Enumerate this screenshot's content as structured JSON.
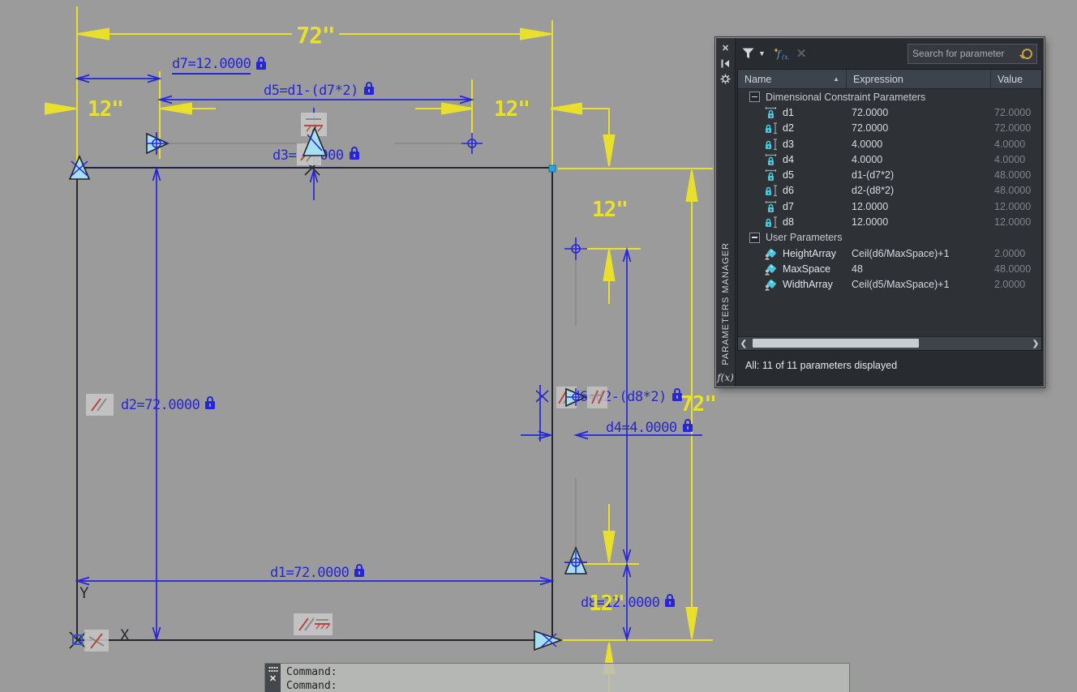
{
  "canvas": {
    "yellow_labels": {
      "top_width": "72\"",
      "top_left_gap": "12\"",
      "top_right_gap": "12\"",
      "right_height": "72\"",
      "right_top_offset": "12\"",
      "right_bottom_offset": "12\""
    },
    "dims": {
      "d7": "d7=12.0000",
      "d5": "d5=d1-(d7*2)",
      "d3": "d3=4.0000",
      "d2": "d2=72.0000",
      "d1": "d1=72.0000",
      "d6": "d6=d2-(d8*2)",
      "d4": "d4=4.0000",
      "d8": "d8=12.0000"
    },
    "axis": {
      "x": "X",
      "y": "Y"
    }
  },
  "command_window": {
    "line1": "Command:",
    "line2": "Command:"
  },
  "palette": {
    "title": "PARAMETERS MANAGER",
    "fx_label": "f(x)",
    "search_placeholder": "Search for parameter",
    "columns": {
      "name": "Name",
      "expression": "Expression",
      "value": "Value"
    },
    "status": "All: 11 of 11 parameters displayed",
    "groups": [
      {
        "label": "Dimensional Constraint Parameters",
        "rows": [
          {
            "icon": "dim-h",
            "name": "d1",
            "expression": "72.0000",
            "value": "72.0000"
          },
          {
            "icon": "dim-v",
            "name": "d2",
            "expression": "72.0000",
            "value": "72.0000"
          },
          {
            "icon": "dim-v",
            "name": "d3",
            "expression": "4.0000",
            "value": "4.0000"
          },
          {
            "icon": "dim-h",
            "name": "d4",
            "expression": "4.0000",
            "value": "4.0000"
          },
          {
            "icon": "dim-h",
            "name": "d5",
            "expression": "d1-(d7*2)",
            "value": "48.0000"
          },
          {
            "icon": "dim-v",
            "name": "d6",
            "expression": "d2-(d8*2)",
            "value": "48.0000"
          },
          {
            "icon": "dim-h",
            "name": "d7",
            "expression": "12.0000",
            "value": "12.0000"
          },
          {
            "icon": "dim-v",
            "name": "d8",
            "expression": "12.0000",
            "value": "12.0000"
          }
        ]
      },
      {
        "label": "User Parameters",
        "rows": [
          {
            "icon": "user",
            "name": "HeightArray",
            "expression": "Ceil(d6/MaxSpace)+1",
            "value": "2.0000"
          },
          {
            "icon": "user",
            "name": "MaxSpace",
            "expression": "48",
            "value": "48.0000"
          },
          {
            "icon": "user",
            "name": "WidthArray",
            "expression": "Ceil(d5/MaxSpace)+1",
            "value": "2.0000"
          }
        ]
      }
    ]
  }
}
